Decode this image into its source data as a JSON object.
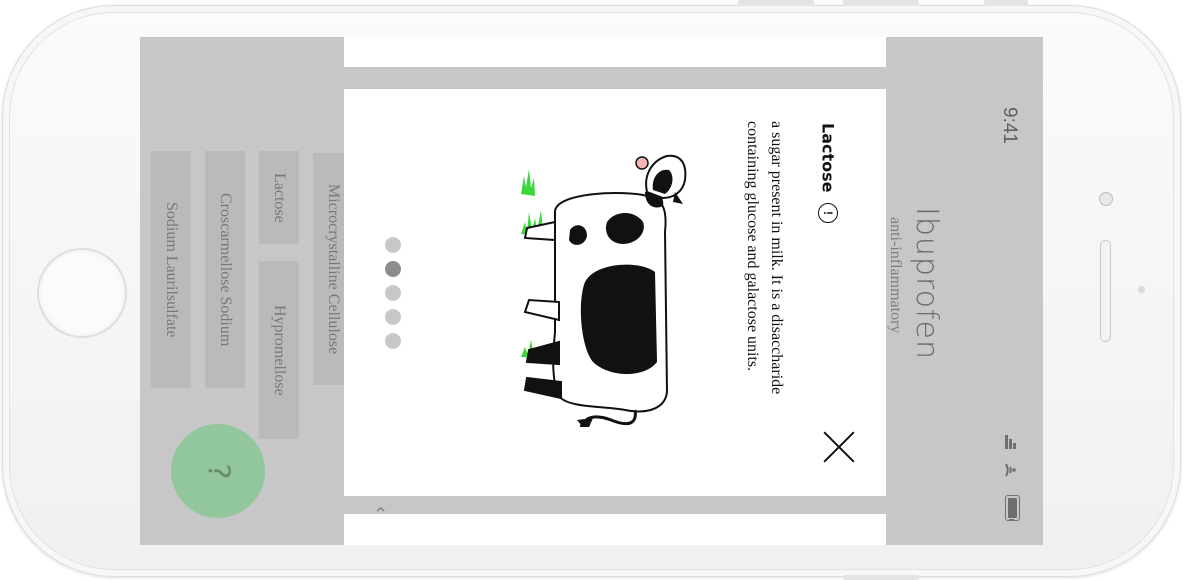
{
  "status_bar": {
    "time": "9:41"
  },
  "app": {
    "title": "Ibuprofen",
    "subtitle": "anti-inflammatory",
    "ingredients": [
      "Microcrystalline Cellulose",
      "Lactose",
      "Hypromellose",
      "Croscarmellose Sodium",
      "Sodium Laurilsulfate"
    ],
    "help_label": "?"
  },
  "modal": {
    "term": "Lactose",
    "info_icon": "!",
    "definition": "a sugar present in milk. It is a disaccharide containing glucose and galactose units.",
    "illustration": "cow-illustration",
    "pagination": {
      "count": 5,
      "active_index": 1
    }
  },
  "colors": {
    "overlay": "#c7c7c7",
    "help_button": "#92c69c",
    "grass": "#3bd63b",
    "modal_bg": "#ffffff"
  }
}
